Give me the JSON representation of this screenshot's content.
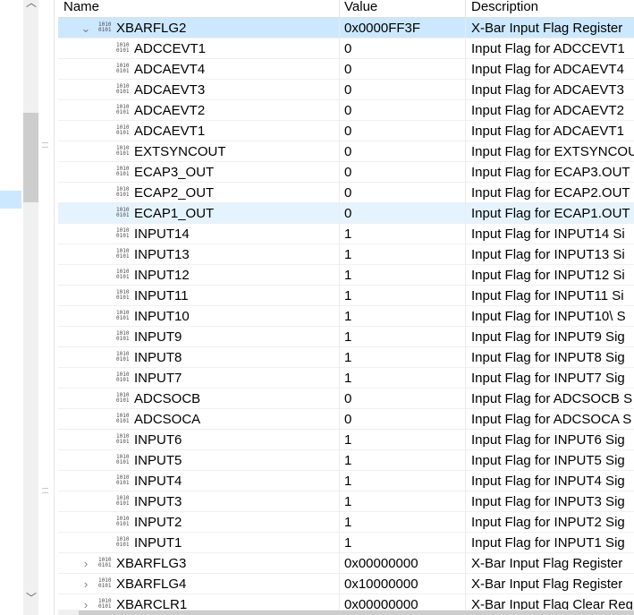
{
  "columns": {
    "name": "Name",
    "value": "Value",
    "description": "Description"
  },
  "parent": {
    "name": "XBARFLG2",
    "value": "0x0000FF3F",
    "description": "X-Bar Input Flag Register"
  },
  "fields": [
    {
      "name": "ADCCEVT1",
      "value": "0",
      "description": "Input Flag for ADCCEVT1"
    },
    {
      "name": "ADCAEVT4",
      "value": "0",
      "description": "Input Flag for ADCAEVT4"
    },
    {
      "name": "ADCAEVT3",
      "value": "0",
      "description": "Input Flag for ADCAEVT3"
    },
    {
      "name": "ADCAEVT2",
      "value": "0",
      "description": "Input Flag for ADCAEVT2"
    },
    {
      "name": "ADCAEVT1",
      "value": "0",
      "description": "Input Flag for ADCAEVT1"
    },
    {
      "name": "EXTSYNCOUT",
      "value": "0",
      "description": "Input Flag for EXTSYNCOUT"
    },
    {
      "name": "ECAP3_OUT",
      "value": "0",
      "description": "Input Flag for ECAP3.OUT"
    },
    {
      "name": "ECAP2_OUT",
      "value": "0",
      "description": "Input Flag for ECAP2.OUT"
    },
    {
      "name": "ECAP1_OUT",
      "value": "0",
      "description": "Input Flag for ECAP1.OUT"
    },
    {
      "name": "INPUT14",
      "value": "1",
      "description": "Input Flag for INPUT14 Si"
    },
    {
      "name": "INPUT13",
      "value": "1",
      "description": "Input Flag for INPUT13 Si"
    },
    {
      "name": "INPUT12",
      "value": "1",
      "description": "Input Flag for INPUT12 Si"
    },
    {
      "name": "INPUT11",
      "value": "1",
      "description": "Input Flag for INPUT11 Si"
    },
    {
      "name": "INPUT10",
      "value": "1",
      "description": "Input Flag for INPUT10\\ S"
    },
    {
      "name": "INPUT9",
      "value": "1",
      "description": "Input Flag for INPUT9 Sig"
    },
    {
      "name": "INPUT8",
      "value": "1",
      "description": "Input Flag for INPUT8 Sig"
    },
    {
      "name": "INPUT7",
      "value": "1",
      "description": "Input Flag for INPUT7 Sig"
    },
    {
      "name": "ADCSOCB",
      "value": "0",
      "description": "Input Flag for ADCSOCB S"
    },
    {
      "name": "ADCSOCA",
      "value": "0",
      "description": "Input Flag for ADCSOCA S"
    },
    {
      "name": "INPUT6",
      "value": "1",
      "description": "Input Flag for INPUT6 Sig"
    },
    {
      "name": "INPUT5",
      "value": "1",
      "description": "Input Flag for INPUT5 Sig"
    },
    {
      "name": "INPUT4",
      "value": "1",
      "description": "Input Flag for INPUT4 Sig"
    },
    {
      "name": "INPUT3",
      "value": "1",
      "description": "Input Flag for INPUT3 Sig"
    },
    {
      "name": "INPUT2",
      "value": "1",
      "description": "Input Flag for INPUT2 Sig"
    },
    {
      "name": "INPUT1",
      "value": "1",
      "description": "Input Flag for INPUT1 Sig"
    }
  ],
  "siblings": [
    {
      "name": "XBARFLG3",
      "value": "0x00000000",
      "description": "X-Bar Input Flag Register"
    },
    {
      "name": "XBARFLG4",
      "value": "0x10000000",
      "description": "X-Bar Input Flag Register"
    },
    {
      "name": "XBARCLR1",
      "value": "0x00000000",
      "description": "X-Bar Input Flag Clear Reg"
    }
  ],
  "icons": {
    "register_icon": "register-binary-icon",
    "expanded": "chevron-down-icon",
    "collapsed": "chevron-right-icon",
    "scroll_up": "scroll-up-arrow-icon",
    "scroll_down": "scroll-down-arrow-icon"
  },
  "glyphs": {
    "expanded": "⌄",
    "collapsed": "›",
    "scroll_up": "︿",
    "scroll_down": "﹀",
    "binary_top": "1010",
    "binary_bottom": "0101"
  },
  "colors": {
    "selected_row": "#e5f3ff",
    "highlight_row": "#cce8ff",
    "scroll_thumb": "#cdcdcd"
  },
  "state": {
    "selected_field": "ECAP1_OUT"
  }
}
